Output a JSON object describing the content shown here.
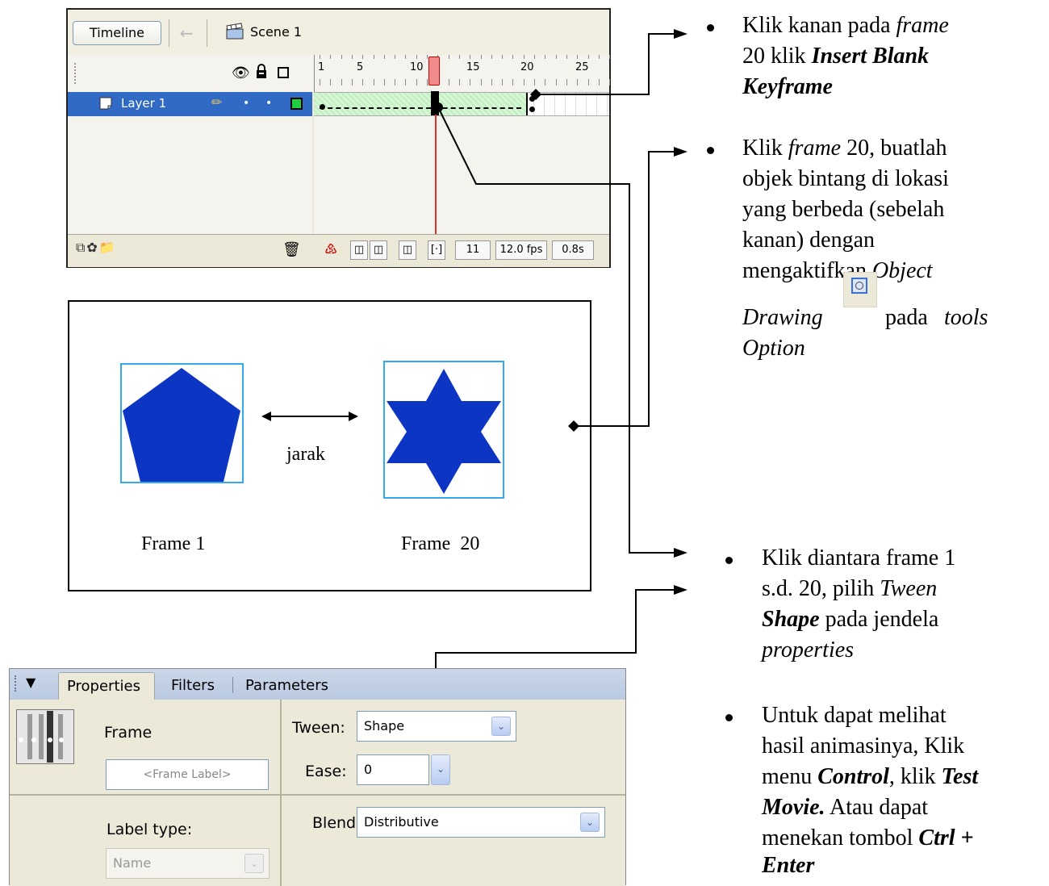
{
  "timeline": {
    "tab_label": "Timeline",
    "scene_label": "Scene 1",
    "ruler_numbers": [
      "1",
      "5",
      "10",
      "15",
      "20",
      "25"
    ],
    "layer_name": "Layer 1",
    "current_frame": "11",
    "fps": "12.0 fps",
    "time": "0.8s"
  },
  "stage": {
    "distance_label": "jarak",
    "frame1_label": "Frame 1",
    "frame20_label": "Frame  20",
    "shape_color": "#0d35c4",
    "frame_box_color": "#33aaee"
  },
  "properties": {
    "tabs": [
      "Properties",
      "Filters",
      "Parameters"
    ],
    "frame_label": "Frame",
    "frame_label_placeholder": "<Frame Label>",
    "label_type_label": "Label type:",
    "label_type_value": "Name",
    "tween_label": "Tween:",
    "tween_value": "Shape",
    "ease_label": "Ease:",
    "ease_value": "0",
    "blend_label": "Blend:",
    "blend_value": "Distributive"
  },
  "instructions": {
    "step1": {
      "a": "Klik kanan pada ",
      "b": "frame",
      "c": "20 klik ",
      "d": "Insert Blank",
      "e": "Keyframe"
    },
    "step2": {
      "a": "Klik ",
      "b": "frame",
      "c": " 20, buatlah",
      "line2": "objek bintang di lokasi",
      "line3": "yang berbeda (sebelah",
      "line4": "kanan) dengan",
      "line5a": "mengaktifkan ",
      "line5b": "Object",
      "line6a": "Drawing",
      "line6b": "pada ",
      "line6c": "tools",
      "line7": "Option"
    },
    "step3": {
      "line1": "Klik diantara frame 1",
      "line2a": "s.d. 20, pilih ",
      "line2b": "Tween",
      "line3a": "Shape",
      "line3b": " pada jendela",
      "line4": "properties"
    },
    "step4": {
      "line1": "Untuk dapat melihat",
      "line2": "hasil animasinya, Klik",
      "line3a": "menu ",
      "line3b": "Control",
      "line3c": ", klik ",
      "line3d": "Test",
      "line4a": "Movie.",
      "line4b": " Atau dapat",
      "line5a": "menekan tombol ",
      "line5b": "Ctrl +",
      "line6": "Enter"
    }
  }
}
